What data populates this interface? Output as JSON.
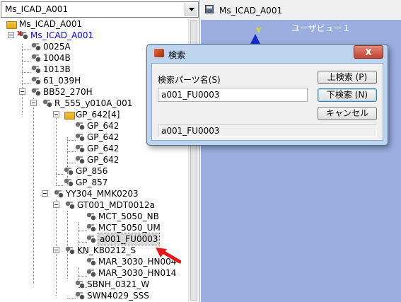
{
  "tree_panel": {
    "selector_value": "Ms_ICAD_A001",
    "nodes": [
      {
        "label": "Ms_ICAD_A001"
      },
      {
        "label": "Ms_ICAD_A001"
      },
      {
        "label": "0025A"
      },
      {
        "label": "1004B"
      },
      {
        "label": "1013B"
      },
      {
        "label": "61_039H"
      },
      {
        "label": "BB52_270H"
      },
      {
        "label": "R_555_y010A_001"
      },
      {
        "label": "GP_642[4]"
      },
      {
        "label": "GP_642"
      },
      {
        "label": "GP_642"
      },
      {
        "label": "GP_642"
      },
      {
        "label": "GP_642"
      },
      {
        "label": "GP_856"
      },
      {
        "label": "GP_857"
      },
      {
        "label": "YY304_MMK0203"
      },
      {
        "label": "GT001_MDT0012a"
      },
      {
        "label": "MCT_5050_NB"
      },
      {
        "label": "MCT_5050_UM"
      },
      {
        "label": "a001_FU0003"
      },
      {
        "label": "KN_KB0212_S"
      },
      {
        "label": "MAR_3030_HN004"
      },
      {
        "label": "MAR_3030_HN014"
      },
      {
        "label": "SBNH_0321_W"
      },
      {
        "label": "SWN4029_SSS"
      }
    ]
  },
  "view_panel": {
    "title": "Ms_ICAD_A001",
    "view_label": "ユーザビュー１",
    "axis_label": "Y",
    "background_color": "#9aaee0"
  },
  "search_dialog": {
    "title": "検索",
    "close_label": "X",
    "field_label": "検索パーツ名(S)",
    "field_value": "a001_FU0003",
    "search_up_label": "上検索 (P)",
    "search_down_label": "下検索 (N)",
    "cancel_label": "キャンセル",
    "status_text": "a001_FU0003"
  },
  "annotation": {
    "arrow_color": "#e8151b"
  }
}
